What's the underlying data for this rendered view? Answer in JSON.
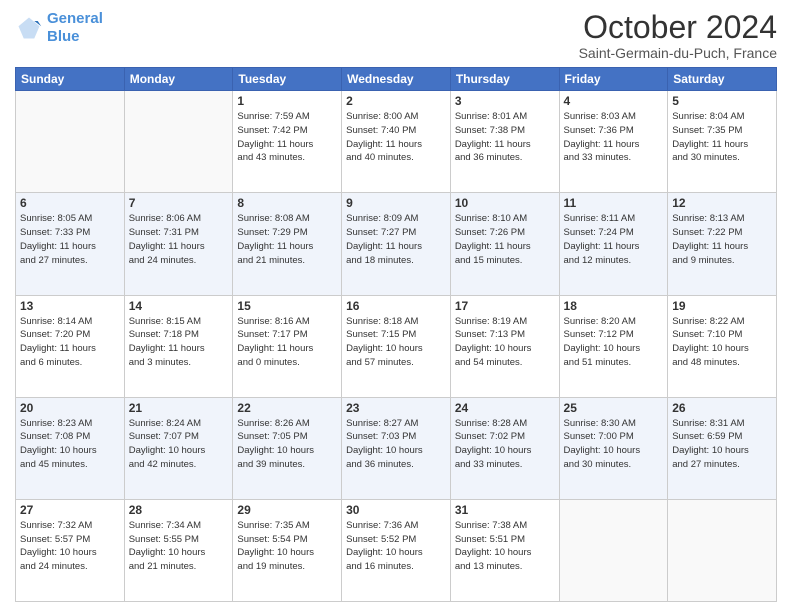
{
  "header": {
    "logo_line1": "General",
    "logo_line2": "Blue",
    "month_title": "October 2024",
    "location": "Saint-Germain-du-Puch, France"
  },
  "weekdays": [
    "Sunday",
    "Monday",
    "Tuesday",
    "Wednesday",
    "Thursday",
    "Friday",
    "Saturday"
  ],
  "weeks": [
    [
      {
        "day": "",
        "info": ""
      },
      {
        "day": "",
        "info": ""
      },
      {
        "day": "1",
        "info": "Sunrise: 7:59 AM\nSunset: 7:42 PM\nDaylight: 11 hours\nand 43 minutes."
      },
      {
        "day": "2",
        "info": "Sunrise: 8:00 AM\nSunset: 7:40 PM\nDaylight: 11 hours\nand 40 minutes."
      },
      {
        "day": "3",
        "info": "Sunrise: 8:01 AM\nSunset: 7:38 PM\nDaylight: 11 hours\nand 36 minutes."
      },
      {
        "day": "4",
        "info": "Sunrise: 8:03 AM\nSunset: 7:36 PM\nDaylight: 11 hours\nand 33 minutes."
      },
      {
        "day": "5",
        "info": "Sunrise: 8:04 AM\nSunset: 7:35 PM\nDaylight: 11 hours\nand 30 minutes."
      }
    ],
    [
      {
        "day": "6",
        "info": "Sunrise: 8:05 AM\nSunset: 7:33 PM\nDaylight: 11 hours\nand 27 minutes."
      },
      {
        "day": "7",
        "info": "Sunrise: 8:06 AM\nSunset: 7:31 PM\nDaylight: 11 hours\nand 24 minutes."
      },
      {
        "day": "8",
        "info": "Sunrise: 8:08 AM\nSunset: 7:29 PM\nDaylight: 11 hours\nand 21 minutes."
      },
      {
        "day": "9",
        "info": "Sunrise: 8:09 AM\nSunset: 7:27 PM\nDaylight: 11 hours\nand 18 minutes."
      },
      {
        "day": "10",
        "info": "Sunrise: 8:10 AM\nSunset: 7:26 PM\nDaylight: 11 hours\nand 15 minutes."
      },
      {
        "day": "11",
        "info": "Sunrise: 8:11 AM\nSunset: 7:24 PM\nDaylight: 11 hours\nand 12 minutes."
      },
      {
        "day": "12",
        "info": "Sunrise: 8:13 AM\nSunset: 7:22 PM\nDaylight: 11 hours\nand 9 minutes."
      }
    ],
    [
      {
        "day": "13",
        "info": "Sunrise: 8:14 AM\nSunset: 7:20 PM\nDaylight: 11 hours\nand 6 minutes."
      },
      {
        "day": "14",
        "info": "Sunrise: 8:15 AM\nSunset: 7:18 PM\nDaylight: 11 hours\nand 3 minutes."
      },
      {
        "day": "15",
        "info": "Sunrise: 8:16 AM\nSunset: 7:17 PM\nDaylight: 11 hours\nand 0 minutes."
      },
      {
        "day": "16",
        "info": "Sunrise: 8:18 AM\nSunset: 7:15 PM\nDaylight: 10 hours\nand 57 minutes."
      },
      {
        "day": "17",
        "info": "Sunrise: 8:19 AM\nSunset: 7:13 PM\nDaylight: 10 hours\nand 54 minutes."
      },
      {
        "day": "18",
        "info": "Sunrise: 8:20 AM\nSunset: 7:12 PM\nDaylight: 10 hours\nand 51 minutes."
      },
      {
        "day": "19",
        "info": "Sunrise: 8:22 AM\nSunset: 7:10 PM\nDaylight: 10 hours\nand 48 minutes."
      }
    ],
    [
      {
        "day": "20",
        "info": "Sunrise: 8:23 AM\nSunset: 7:08 PM\nDaylight: 10 hours\nand 45 minutes."
      },
      {
        "day": "21",
        "info": "Sunrise: 8:24 AM\nSunset: 7:07 PM\nDaylight: 10 hours\nand 42 minutes."
      },
      {
        "day": "22",
        "info": "Sunrise: 8:26 AM\nSunset: 7:05 PM\nDaylight: 10 hours\nand 39 minutes."
      },
      {
        "day": "23",
        "info": "Sunrise: 8:27 AM\nSunset: 7:03 PM\nDaylight: 10 hours\nand 36 minutes."
      },
      {
        "day": "24",
        "info": "Sunrise: 8:28 AM\nSunset: 7:02 PM\nDaylight: 10 hours\nand 33 minutes."
      },
      {
        "day": "25",
        "info": "Sunrise: 8:30 AM\nSunset: 7:00 PM\nDaylight: 10 hours\nand 30 minutes."
      },
      {
        "day": "26",
        "info": "Sunrise: 8:31 AM\nSunset: 6:59 PM\nDaylight: 10 hours\nand 27 minutes."
      }
    ],
    [
      {
        "day": "27",
        "info": "Sunrise: 7:32 AM\nSunset: 5:57 PM\nDaylight: 10 hours\nand 24 minutes."
      },
      {
        "day": "28",
        "info": "Sunrise: 7:34 AM\nSunset: 5:55 PM\nDaylight: 10 hours\nand 21 minutes."
      },
      {
        "day": "29",
        "info": "Sunrise: 7:35 AM\nSunset: 5:54 PM\nDaylight: 10 hours\nand 19 minutes."
      },
      {
        "day": "30",
        "info": "Sunrise: 7:36 AM\nSunset: 5:52 PM\nDaylight: 10 hours\nand 16 minutes."
      },
      {
        "day": "31",
        "info": "Sunrise: 7:38 AM\nSunset: 5:51 PM\nDaylight: 10 hours\nand 13 minutes."
      },
      {
        "day": "",
        "info": ""
      },
      {
        "day": "",
        "info": ""
      }
    ]
  ]
}
